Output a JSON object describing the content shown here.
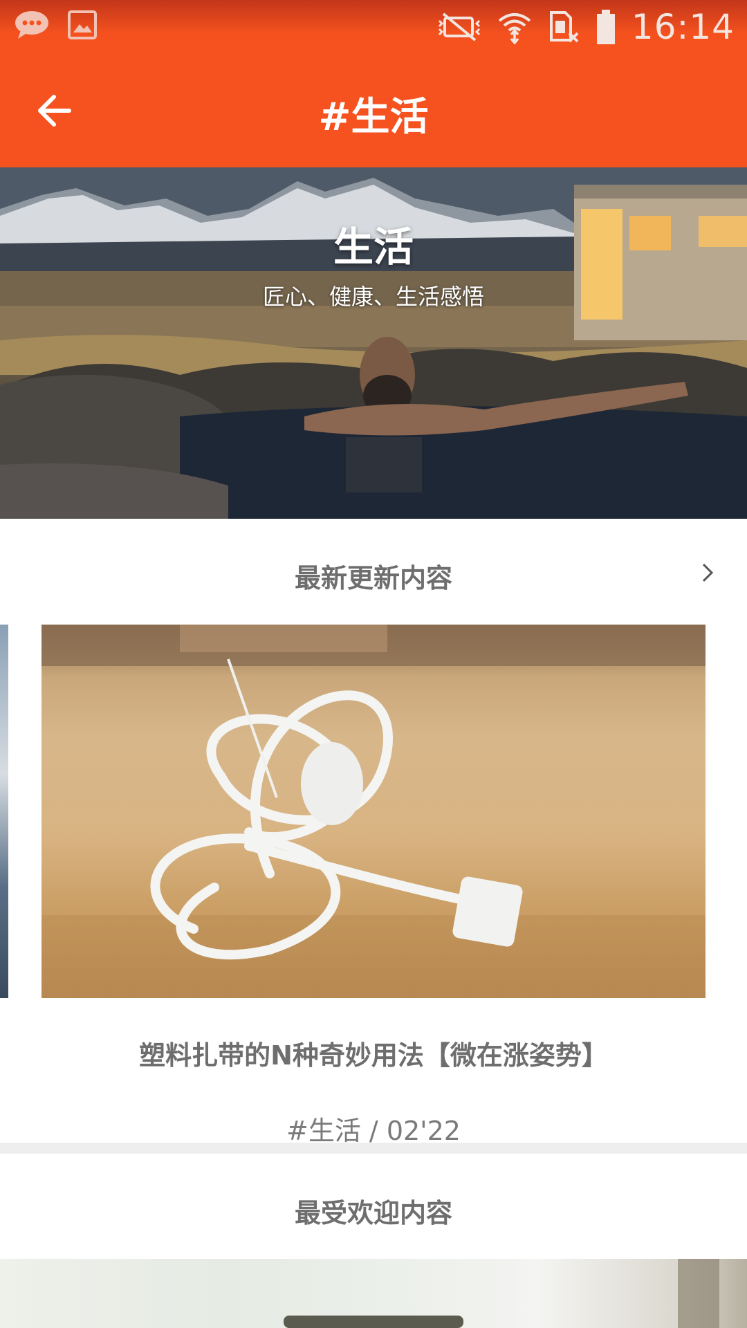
{
  "status_bar": {
    "time": "16:14",
    "left_icons": [
      "message-icon",
      "gallery-icon"
    ],
    "right_icons": [
      "mute-icon",
      "wifi-icon",
      "no-sim-icon",
      "battery-icon"
    ]
  },
  "app_bar": {
    "back_icon": "arrow-left-icon",
    "title": "#生活"
  },
  "hero": {
    "title": "生活",
    "subtitle": "匠心、健康、生活感悟"
  },
  "latest": {
    "section_title": "最新更新内容",
    "more_icon": "chevron-right-icon",
    "card": {
      "title": "塑料扎带的N种奇妙用法【微在涨姿势】",
      "meta": "#生活 / 02'22"
    }
  },
  "popular": {
    "section_title": "最受欢迎内容"
  },
  "colors": {
    "accent": "#f6521f",
    "section_text": "#6e6e6e",
    "divider": "#eeeeee"
  }
}
